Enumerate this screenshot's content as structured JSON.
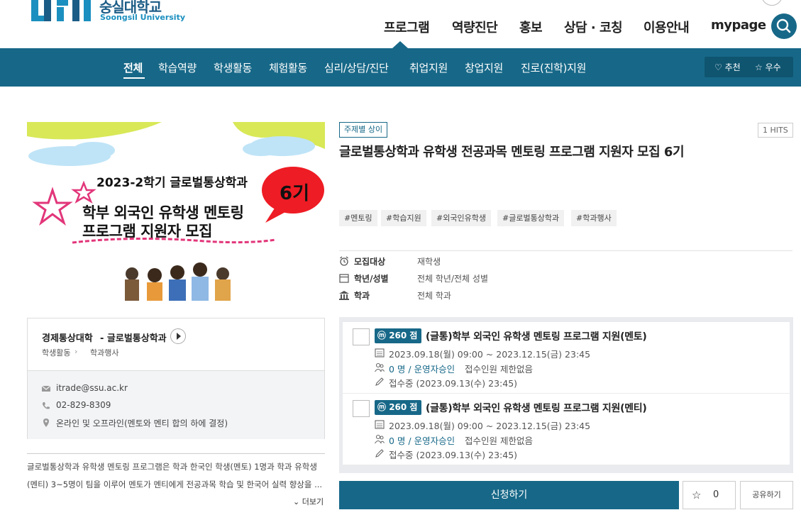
{
  "header": {
    "logo_kr": "숭실대학교",
    "logo_en": "Soongsil University",
    "nav": [
      "프로그램",
      "역량진단",
      "홍보",
      "상담 · 코칭",
      "이용안내",
      "mypage"
    ]
  },
  "subnav": {
    "items": [
      "전체",
      "학습역량",
      "학생활동",
      "체험활동",
      "심리/상담/진단",
      "취업지원",
      "창업지원",
      "진로(진학)지원"
    ],
    "active": "전체",
    "recommend_label": "추천",
    "excellent_label": "우수"
  },
  "poster": {
    "line1": "2023-2학기 글로벌통상학과",
    "badge": "6기",
    "line2": "학부 외국인 유학생 멘토링",
    "line3": "프로그램 지원자 모집"
  },
  "info": {
    "college": "경제통상대학",
    "department": "- 글로벌통상학과",
    "category1": "학생활동",
    "category2": "학과행사",
    "email": "itrade@ssu.ac.kr",
    "phone": "02-829-8309",
    "location": "온라인 및 오프라인(멘토와 멘티 합의 하에 결정)"
  },
  "description": {
    "line1": "글로벌통상학과 유학생 멘토링 프로그램은 학과 한국인 학생(멘토) 1명과 학과 유학생",
    "line2": "(멘티) 3~5명이 팀을 이루어 멘토가 멘티에게 전공과목 학습 및 한국어 실력 향상을 ...",
    "more_label": "더보기"
  },
  "program": {
    "category_badge": "주제별 상이",
    "hits": "1 HITS",
    "title": "글로벌통상학과 유학생 전공과목 멘토링 프로그램 지원자 모집 6기",
    "tags": [
      "#멘토링",
      "#학습지원",
      "#외국인유학생",
      "#글로벌통상학과",
      "#학과행사"
    ],
    "meta": [
      {
        "label": "모집대상",
        "value": "재학생"
      },
      {
        "label": "학년/성별",
        "value": "전체 학년/전체 성별"
      },
      {
        "label": "학과",
        "value": "전체 학과"
      }
    ]
  },
  "sessions": [
    {
      "points": "260 점",
      "name": "(글통)학부 외국인 유학생 멘토링 프로그램 지원(멘토)",
      "period": "2023.09.18(월) 09:00 ~ 2023.12.15(금) 23:45",
      "count": "0 명 / 운영자승인",
      "limit": "접수인원 제한없음",
      "status": "접수중 (2023.09.13(수) 23:45)"
    },
    {
      "points": "260 점",
      "name": "(글통)학부 외국인 유학생 멘토링 프로그램 지원(멘티)",
      "period": "2023.09.18(월) 09:00 ~ 2023.12.15(금) 23:45",
      "count": "0 명 / 운영자승인",
      "limit": "접수인원 제한없음",
      "status": "접수중 (2023.09.13(수) 23:45)"
    }
  ],
  "actions": {
    "apply_label": "신청하기",
    "like_count": "0",
    "share_label": "공유하기"
  }
}
